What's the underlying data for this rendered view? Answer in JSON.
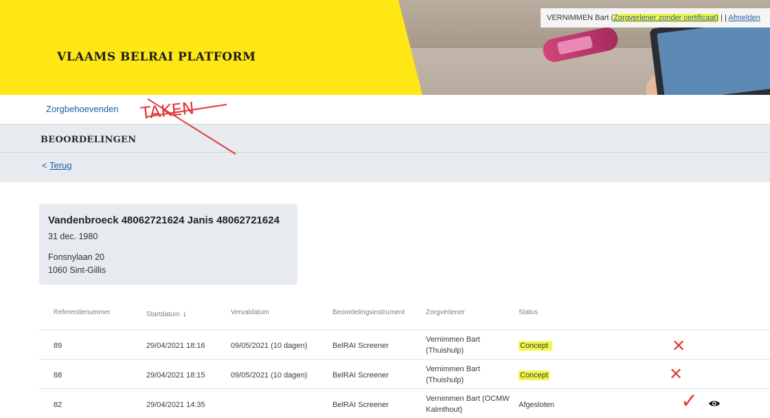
{
  "header": {
    "brand": "VLAAMS BELRAI PLATFORM",
    "user_name": "VERNIMMEN Bart (",
    "user_role": "Zorgverlener zonder certificaat",
    "user_close": ")",
    "separator": "| |",
    "logout": "Afmelden"
  },
  "nav": {
    "link": "Zorgbehoevenden",
    "annotation": "TAKEN"
  },
  "page": {
    "title": "BEOORDELINGEN",
    "back_arrow": "<",
    "back": "Terug"
  },
  "patient": {
    "name": "Vandenbroeck 48062721624 Janis 48062721624",
    "birthdate": "31 dec. 1980",
    "street": "Fonsnylaan 20",
    "city": "1060 Sint-Gillis"
  },
  "table": {
    "columns": [
      "Referentienummer",
      "Startdatum",
      "Vervaldatum",
      "Beoordelingsinstrument",
      "Zorgverlener",
      "Status"
    ],
    "rows": [
      {
        "ref": "89",
        "start": "29/04/2021 18:16",
        "end": "09/05/2021 (10 dagen)",
        "instrument": "BelRAI Screener",
        "provider": "Vernimmen Bart (Thuishulp)",
        "status": "Concept"
      },
      {
        "ref": "88",
        "start": "29/04/2021 18:15",
        "end": "09/05/2021 (10 dagen)",
        "instrument": "BelRAI Screener",
        "provider": "Vernimmen Bart (Thuishulp)",
        "status": "Concept"
      },
      {
        "ref": "82",
        "start": "29/04/2021 14:35",
        "end": "",
        "instrument": "BelRAI Screener",
        "provider": "Vernimmen Bart (OCMW Kalmthout)",
        "status": "Afgesloten"
      }
    ]
  },
  "annotations": {
    "x_mark": "✕",
    "check_mark": "✓",
    "color": "#e23a3a"
  },
  "colors": {
    "brand_yellow": "#ffe615",
    "link_blue": "#1f57a6",
    "highlight": "#f3f64a"
  }
}
